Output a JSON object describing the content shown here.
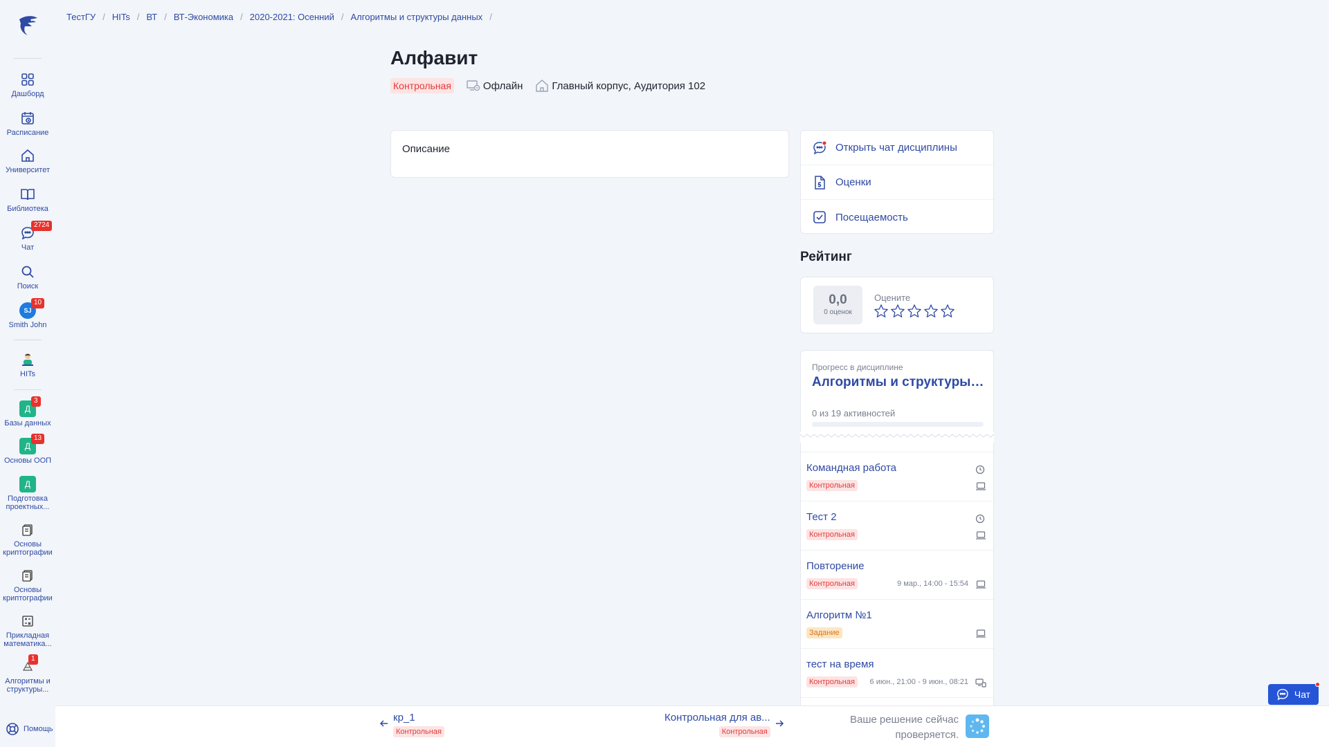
{
  "breadcrumb": [
    "ТестГУ",
    "HITs",
    "ВТ",
    "ВТ-Экономика",
    "2020-2021: Осенний",
    "Алгоритмы и структуры данных"
  ],
  "breadcrumb_sep": "/",
  "sidebar": {
    "items": [
      {
        "label": "Дашборд",
        "icon": "dashboard-icon"
      },
      {
        "label": "Расписание",
        "icon": "schedule-icon"
      },
      {
        "label": "Университет",
        "icon": "university-icon"
      },
      {
        "label": "Библиотека",
        "icon": "library-icon"
      },
      {
        "label": "Чат",
        "icon": "chat-icon",
        "badge": "2724"
      },
      {
        "label": "Поиск",
        "icon": "search-icon"
      },
      {
        "label": "Smith John",
        "avatar": "SJ",
        "badge": "10"
      }
    ],
    "groups": [
      {
        "label": "HITs"
      }
    ],
    "courses": [
      {
        "label": "Базы данных",
        "letter": "Д",
        "badge": "3"
      },
      {
        "label": "Основы ООП",
        "letter": "Д",
        "badge": "13"
      },
      {
        "label": "Подготовка проектных...",
        "letter": "Д"
      },
      {
        "label": "Основы криптографии"
      },
      {
        "label": "Основы криптографии"
      },
      {
        "label": "Прикладная математика..."
      },
      {
        "label": "Алгоритмы и структуры...",
        "badge": "1"
      }
    ],
    "help": "Помощь"
  },
  "page": {
    "title": "Алфавит",
    "type_tag": "Контрольная",
    "format": "Офлайн",
    "location": "Главный корпус, Аудитория 102",
    "description_label": "Описание"
  },
  "links": [
    {
      "label": "Открыть чат дисциплины",
      "icon": "chat-bubble-icon"
    },
    {
      "label": "Оценки",
      "icon": "grades-doc-icon"
    },
    {
      "label": "Посещаемость",
      "icon": "attendance-check-icon"
    }
  ],
  "rating": {
    "heading": "Рейтинг",
    "score": "0,0",
    "count": "0 оценок",
    "prompt": "Оцените",
    "stars": 5
  },
  "progress": {
    "subtitle": "Прогресс в дисциплине",
    "course": "Алгоритмы и структуры данных",
    "count_text": "0 из 19 активностей",
    "fraction": 0
  },
  "activities": [
    {
      "title": "Командная работа",
      "tag": "Контрольная",
      "tag_type": "kr",
      "clock": true,
      "date": ""
    },
    {
      "title": "Тест 2",
      "tag": "Контрольная",
      "tag_type": "kr",
      "clock": true,
      "date": ""
    },
    {
      "title": "Повторение",
      "tag": "Контрольная",
      "tag_type": "kr",
      "clock": false,
      "date": "9 мар., 14:00 - 15:54"
    },
    {
      "title": "Алгоритм №1",
      "tag": "Задание",
      "tag_type": "zd",
      "clock": false,
      "date": ""
    },
    {
      "title": "тест на время",
      "tag": "Контрольная",
      "tag_type": "kr",
      "clock": false,
      "date": "6 июн., 21:00 - 9 июн., 08:21"
    }
  ],
  "nav": {
    "prev_title": "кр_1",
    "prev_tag": "Контрольная",
    "next_title": "Контрольная для ав...",
    "next_tag": "Контрольная",
    "checking_line1": "Ваше решение сейчас",
    "checking_line2": "проверяется."
  },
  "chat_button": "Чат",
  "colors": {
    "accent": "#2e4aa3",
    "danger": "#e23b3b",
    "warning": "#d9761c",
    "brand_green": "#21b48a",
    "chat_blue": "#2555d6"
  }
}
